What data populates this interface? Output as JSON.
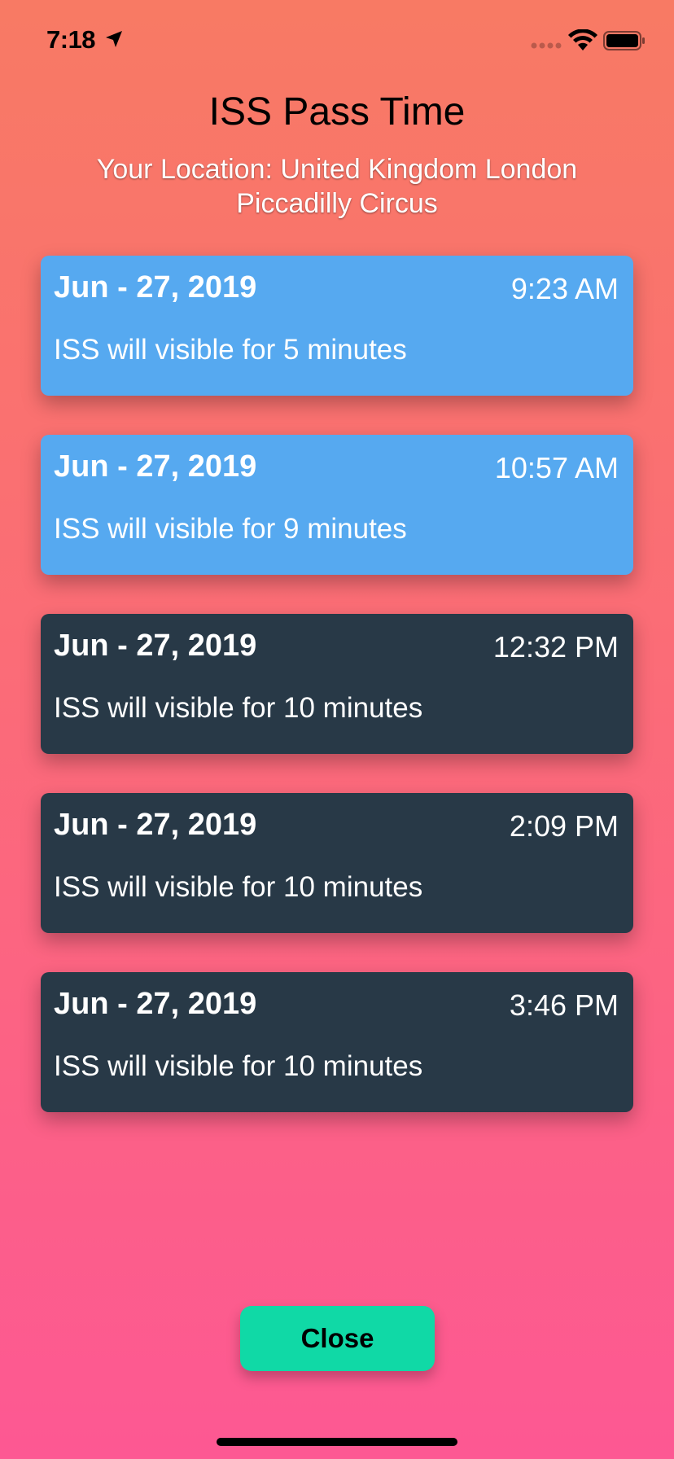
{
  "status_bar": {
    "time": "7:18",
    "icons": [
      "location-arrow-icon",
      "cellular-signal-icon",
      "wifi-icon",
      "battery-icon"
    ]
  },
  "header": {
    "title": "ISS Pass Time",
    "location_line1": "Your Location: United Kingdom London",
    "location_line2": "Piccadilly Circus"
  },
  "passes": [
    {
      "date": "Jun - 27, 2019",
      "time": "9:23 AM",
      "duration": "ISS will visible for 5 minutes",
      "style": "blue"
    },
    {
      "date": "Jun - 27, 2019",
      "time": "10:57 AM",
      "duration": "ISS will visible for 9 minutes",
      "style": "blue"
    },
    {
      "date": "Jun - 27, 2019",
      "time": "12:32 PM",
      "duration": "ISS will visible for 10 minutes",
      "style": "dark"
    },
    {
      "date": "Jun - 27, 2019",
      "time": "2:09 PM",
      "duration": "ISS will visible for 10 minutes",
      "style": "dark"
    },
    {
      "date": "Jun - 27, 2019",
      "time": "3:46 PM",
      "duration": "ISS will visible for 10 minutes",
      "style": "dark"
    }
  ],
  "actions": {
    "close_label": "Close"
  },
  "colors": {
    "gradient_top": "#f87a64",
    "gradient_bottom": "#fd5893",
    "card_blue": "#56a9f0",
    "card_dark": "#283947",
    "close_button": "#10d9a6"
  }
}
